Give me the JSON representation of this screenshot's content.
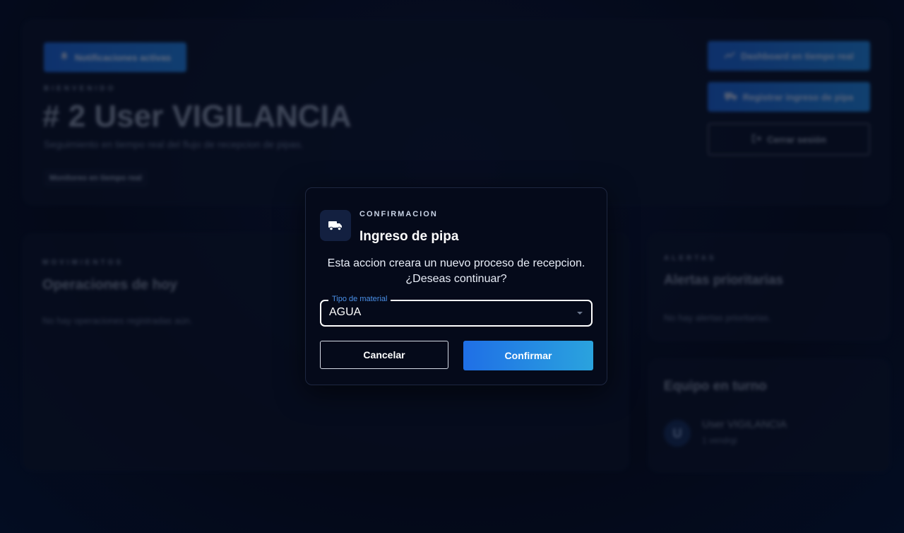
{
  "background": {
    "header": {
      "notifications_button": "Notificaciones activas",
      "eyebrow": "BIENVENIDO",
      "title": "# 2 User VIGILANCIA",
      "subtitle": "Seguimiento en tiempo real del flujo de recepcion de pipas.",
      "tag": "Monitoreo en tiempo real",
      "actions": {
        "dashboard": "Dashboard en tiempo real",
        "register": "Registrar ingreso de pipa",
        "logout": "Cerrar sesión"
      }
    },
    "operations": {
      "eyebrow": "MOVIMIENTOS",
      "title": "Operaciones de hoy",
      "empty": "No hay operaciones registradas aún."
    },
    "alerts": {
      "eyebrow": "ALERTAS",
      "title": "Alertas prioritarias",
      "empty": "No hay alertas prioritarias."
    },
    "team": {
      "title": "Equipo en turno",
      "member": {
        "initial": "U",
        "name": "User VIGILANCIA",
        "meta": "1 vendrgi"
      }
    }
  },
  "dialog": {
    "eyebrow": "CONFIRMACION",
    "title": "Ingreso de pipa",
    "message": "Esta accion creara un nuevo proceso de recepcion. ¿Deseas continuar?",
    "field": {
      "label": "Tipo de material",
      "value": "AGUA"
    },
    "cancel": "Cancelar",
    "confirm": "Confirmar"
  },
  "colors": {
    "accent": "#1f6fe6",
    "accent2": "#2aa3de",
    "dialog_bg": "#050a1a"
  }
}
